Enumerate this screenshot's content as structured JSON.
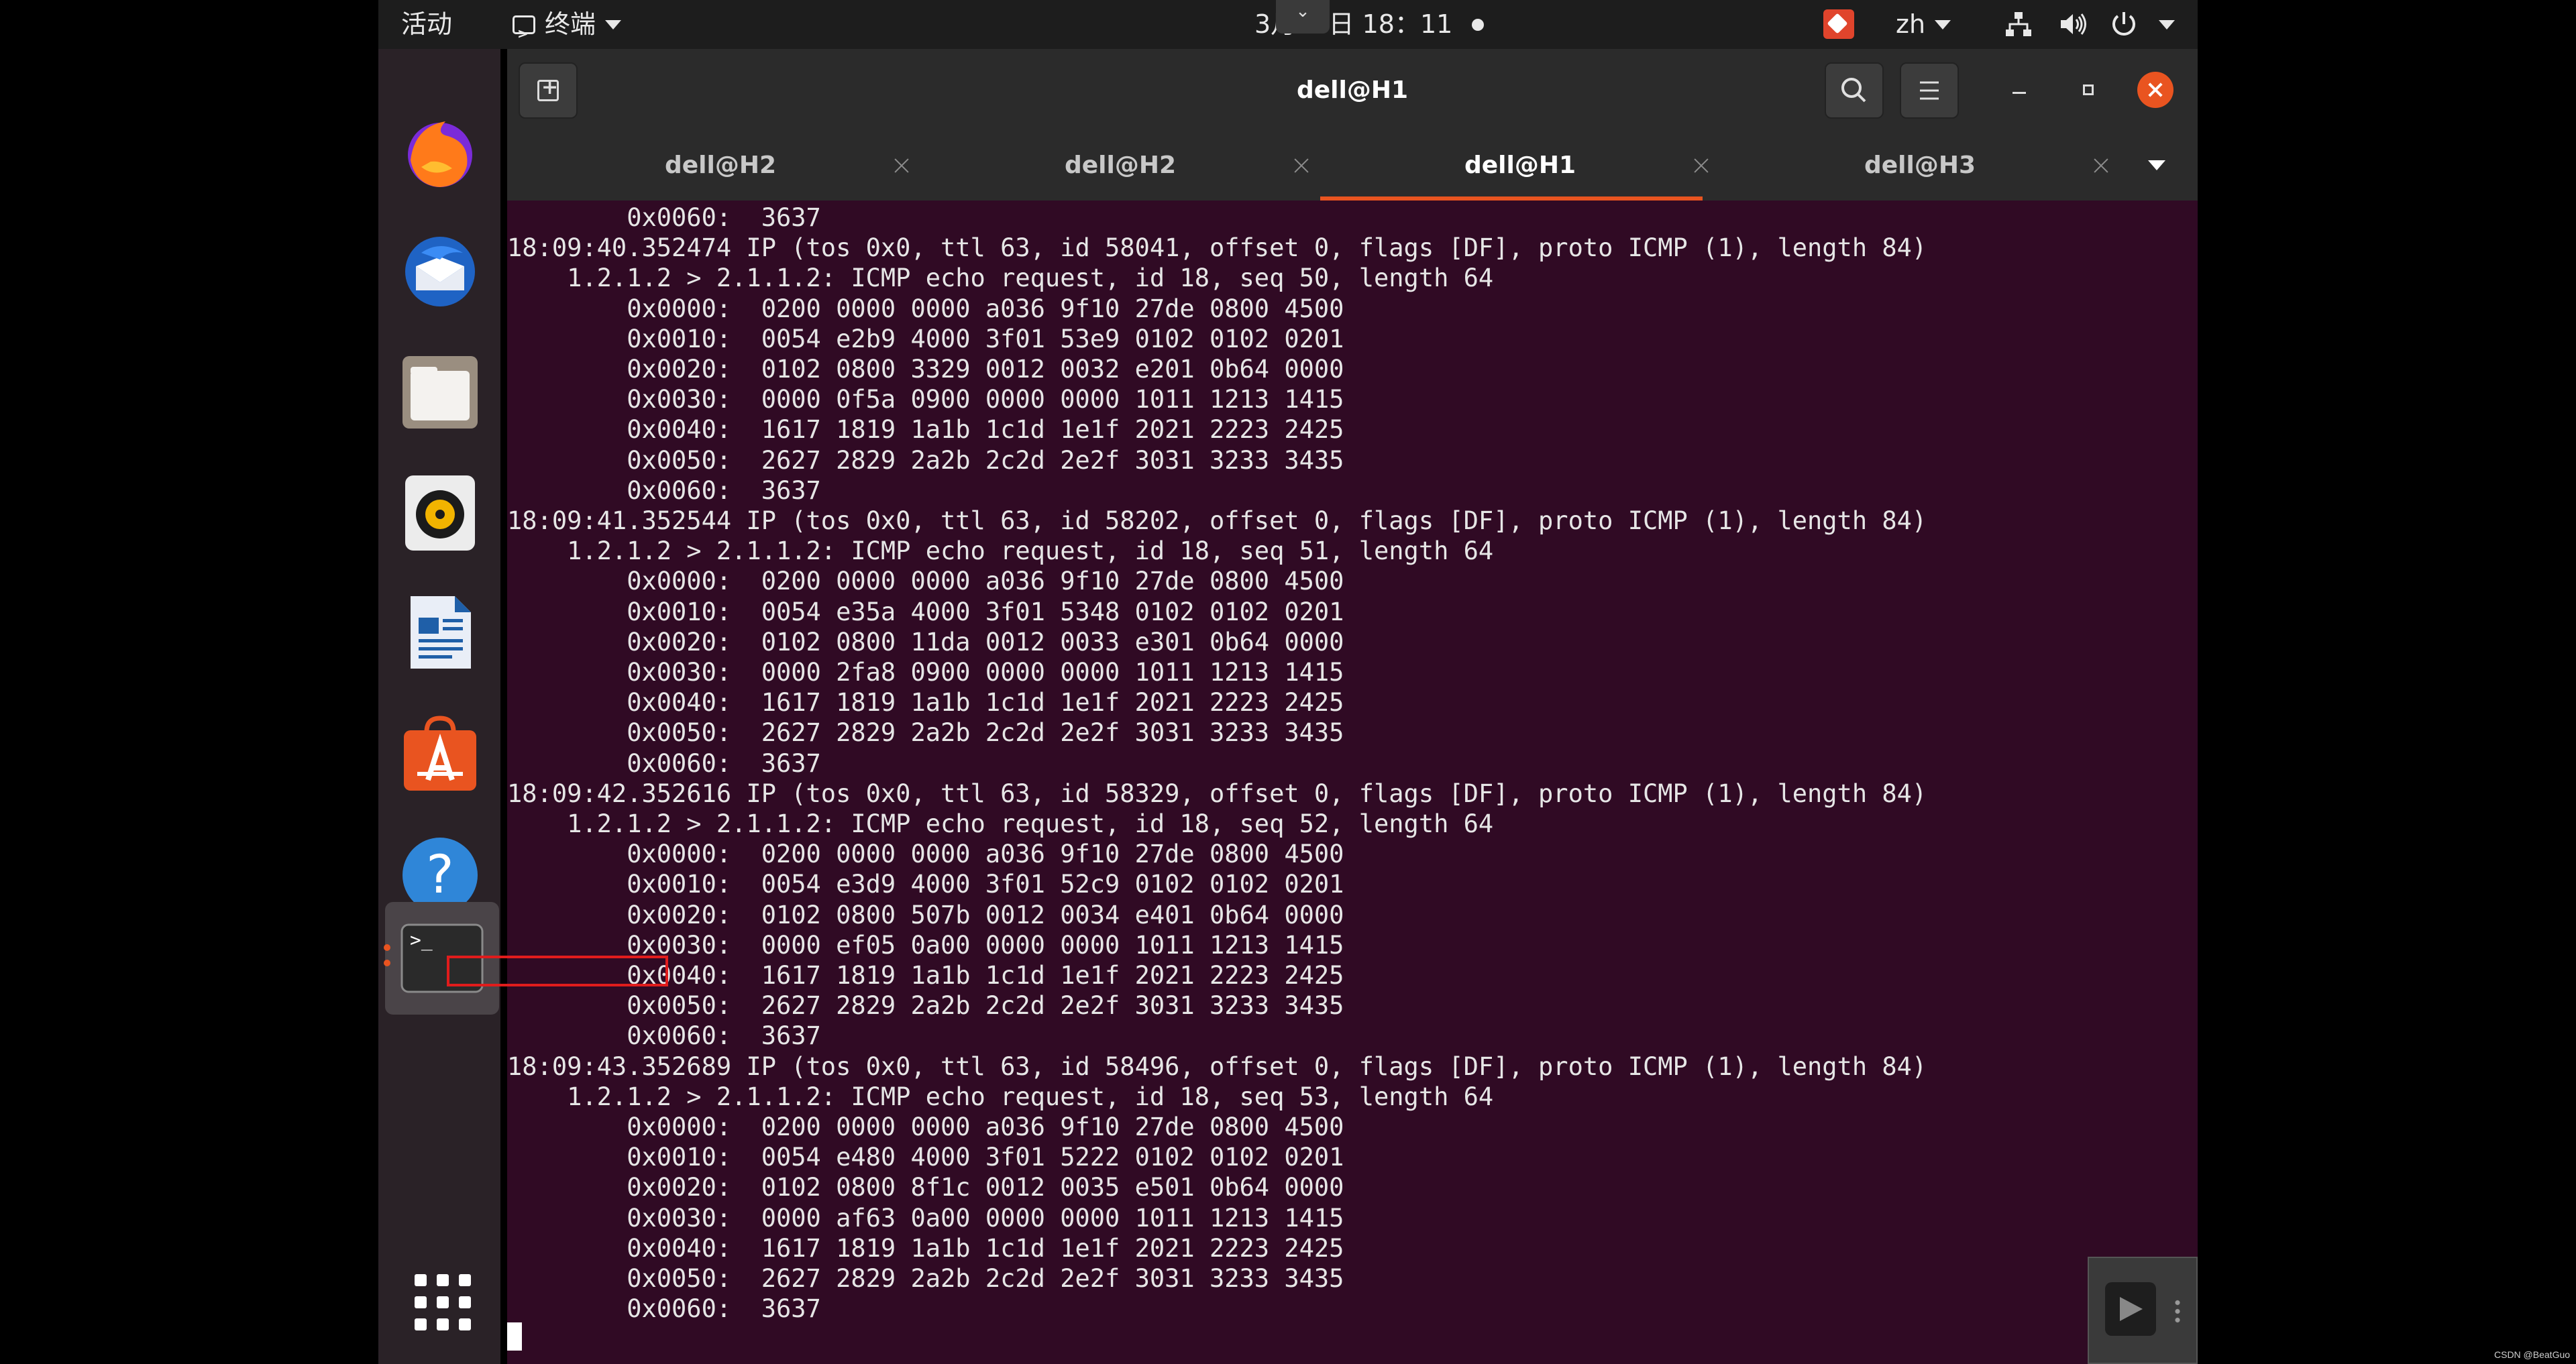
{
  "topbar": {
    "activities": "活动",
    "app_menu_label": "终端",
    "clock": "3月10日  18：11",
    "lang": "zh"
  },
  "window": {
    "title": "dell@H1"
  },
  "tabs": [
    {
      "label": "dell@H2",
      "active": false
    },
    {
      "label": "dell@H2",
      "active": false
    },
    {
      "label": "dell@H1",
      "active": true
    },
    {
      "label": "dell@H3",
      "active": false
    }
  ],
  "terminal": {
    "lines": [
      "        0x0060:  3637",
      "18:09:40.352474 IP (tos 0x0, ttl 63, id 58041, offset 0, flags [DF], proto ICMP (1), length 84)",
      "    1.2.1.2 > 2.1.1.2: ICMP echo request, id 18, seq 50, length 64",
      "        0x0000:  0200 0000 0000 a036 9f10 27de 0800 4500",
      "        0x0010:  0054 e2b9 4000 3f01 53e9 0102 0102 0201",
      "        0x0020:  0102 0800 3329 0012 0032 e201 0b64 0000",
      "        0x0030:  0000 0f5a 0900 0000 0000 1011 1213 1415",
      "        0x0040:  1617 1819 1a1b 1c1d 1e1f 2021 2223 2425",
      "        0x0050:  2627 2829 2a2b 2c2d 2e2f 3031 3233 3435",
      "        0x0060:  3637",
      "18:09:41.352544 IP (tos 0x0, ttl 63, id 58202, offset 0, flags [DF], proto ICMP (1), length 84)",
      "    1.2.1.2 > 2.1.1.2: ICMP echo request, id 18, seq 51, length 64",
      "        0x0000:  0200 0000 0000 a036 9f10 27de 0800 4500",
      "        0x0010:  0054 e35a 4000 3f01 5348 0102 0102 0201",
      "        0x0020:  0102 0800 11da 0012 0033 e301 0b64 0000",
      "        0x0030:  0000 2fa8 0900 0000 0000 1011 1213 1415",
      "        0x0040:  1617 1819 1a1b 1c1d 1e1f 2021 2223 2425",
      "        0x0050:  2627 2829 2a2b 2c2d 2e2f 3031 3233 3435",
      "        0x0060:  3637",
      "18:09:42.352616 IP (tos 0x0, ttl 63, id 58329, offset 0, flags [DF], proto ICMP (1), length 84)",
      "    1.2.1.2 > 2.1.1.2: ICMP echo request, id 18, seq 52, length 64",
      "        0x0000:  0200 0000 0000 a036 9f10 27de 0800 4500",
      "        0x0010:  0054 e3d9 4000 3f01 52c9 0102 0102 0201",
      "        0x0020:  0102 0800 507b 0012 0034 e401 0b64 0000",
      "        0x0030:  0000 ef05 0a00 0000 0000 1011 1213 1415",
      "        0x0040:  1617 1819 1a1b 1c1d 1e1f 2021 2223 2425",
      "        0x0050:  2627 2829 2a2b 2c2d 2e2f 3031 3233 3435",
      "        0x0060:  3637",
      "18:09:43.352689 IP (tos 0x0, ttl 63, id 58496, offset 0, flags [DF], proto ICMP (1), length 84)",
      "    1.2.1.2 > 2.1.1.2: ICMP echo request, id 18, seq 53, length 64",
      "        0x0000:  0200 0000 0000 a036 9f10 27de 0800 4500",
      "        0x0010:  0054 e480 4000 3f01 5222 0102 0102 0201",
      "        0x0020:  0102 0800 8f1c 0012 0035 e501 0b64 0000",
      "        0x0030:  0000 af63 0a00 0000 0000 1011 1213 1415",
      "        0x0040:  1617 1819 1a1b 1c1d 1e1f 2021 2223 2425",
      "        0x0050:  2627 2829 2a2b 2c2d 2e2f 3031 3233 3435",
      "        0x0060:  3637"
    ]
  },
  "dock": {
    "items": [
      "firefox-icon",
      "thunderbird-icon",
      "files-icon",
      "rhythmbox-icon",
      "libreoffice-writer-icon",
      "ubuntu-software-icon",
      "help-icon",
      "terminal-icon",
      "show-applications-icon"
    ]
  },
  "watermark": "CSDN @BeatGuo",
  "colors": {
    "terminal_bg": "#300a24",
    "accent": "#e95420",
    "highlight": "#e01c1c"
  }
}
